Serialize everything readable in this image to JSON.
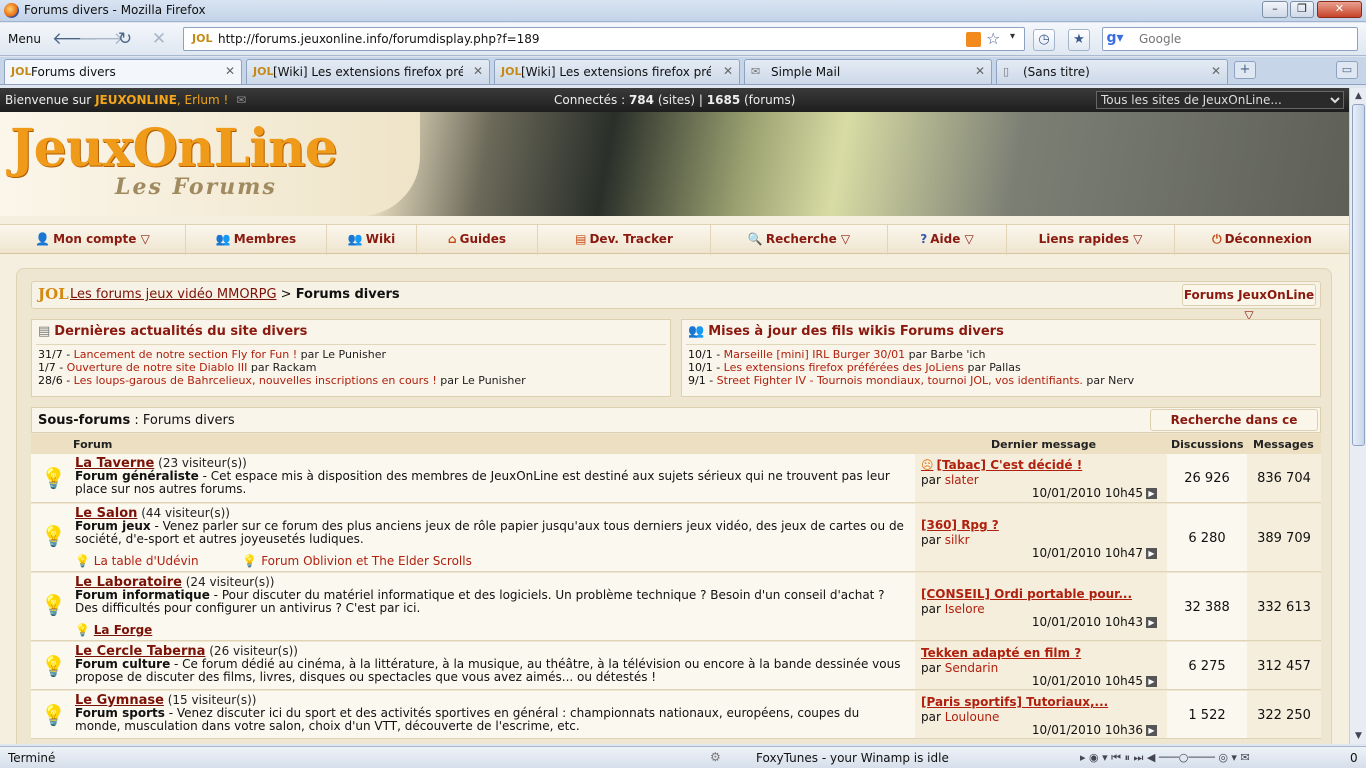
{
  "window": {
    "title": "Forums divers - Mozilla Firefox",
    "min": "–",
    "max": "❐",
    "close": "✕"
  },
  "nav": {
    "menu": "Menu",
    "url": "http://forums.jeuxonline.info/forumdisplay.php?f=189",
    "search_placeholder": "Google"
  },
  "tabs": [
    {
      "label": "Forums divers"
    },
    {
      "label": "[Wiki] Les extensions firefox préféré..."
    },
    {
      "label": "[Wiki] Les extensions firefox préféré..."
    },
    {
      "label": "Simple Mail"
    },
    {
      "label": "(Sans titre)"
    }
  ],
  "topstrip": {
    "welcome_prefix": "Bienvenue sur ",
    "brand": "JEUXONLINE",
    "user": ", Erlum !",
    "conn_label": "Connectés : ",
    "conn_sites": "784",
    "conn_sites_label": " (sites) | ",
    "conn_forums": "1685",
    "conn_forums_label": " (forums)",
    "sites_select": "Tous les sites de JeuxOnLine..."
  },
  "banner": {
    "logo": "JeuxOnLine",
    "subtitle": "Les Forums"
  },
  "mainnav": [
    {
      "label": "Mon compte ▽",
      "icon": "👤"
    },
    {
      "label": "Membres",
      "icon": "👥"
    },
    {
      "label": "Wiki",
      "icon": "👥"
    },
    {
      "label": "Guides",
      "icon": "⌂"
    },
    {
      "label": "Dev. Tracker",
      "icon": "▤"
    },
    {
      "label": "Recherche ▽",
      "icon": "🔍"
    },
    {
      "label": "Aide ▽",
      "icon": "?"
    },
    {
      "label": "Liens rapides ▽",
      "icon": ""
    },
    {
      "label": "Déconnexion",
      "icon": "⏻"
    }
  ],
  "breadcrumb": {
    "logo": "JOL",
    "parent": "Les forums jeux vidéo MMORPG",
    "sep": " > ",
    "current": "Forums divers",
    "dropdown": "Forums JeuxOnLine ▽"
  },
  "news_left": {
    "title": "Dernières actualités du site divers",
    "items": [
      {
        "date": "31/7 - ",
        "link": "Lancement de notre section Fly for Fun !",
        "by": " par Le Punisher"
      },
      {
        "date": "1/7 - ",
        "link": "Ouverture de notre site Diablo III",
        "by": " par Rackam"
      },
      {
        "date": "28/6 - ",
        "link": "Les loups-garous de Bahrcelieux, nouvelles inscriptions en cours !",
        "by": " par Le Punisher"
      }
    ]
  },
  "news_right": {
    "title": "Mises à jour des fils wikis Forums divers",
    "items": [
      {
        "date": "10/1 - ",
        "link": "Marseille [mini] IRL Burger 30/01",
        "by": " par Barbe 'ich"
      },
      {
        "date": "10/1 - ",
        "link": "Les extensions firefox préférées des JoLiens",
        "by": " par Pallas"
      },
      {
        "date": "9/1 - ",
        "link": "Street Fighter IV - Tournois mondiaux, tournoi JOL, vos identifiants.",
        "by": " par Nerv"
      }
    ]
  },
  "subforums": {
    "label": "Sous-forums",
    "sep": " : ",
    "name": "Forums divers",
    "search_btn": "Recherche dans ce forum ▽"
  },
  "table_headers": {
    "forum": "Forum",
    "last": "Dernier message",
    "disc": "Discussions",
    "msgs": "Messages"
  },
  "forums": [
    {
      "title": "La Taverne",
      "visitors": " (23 visiteur(s))",
      "subtitle": "Forum généraliste",
      "desc": " - Cet espace mis à disposition des membres de JeuxOnLine est destiné aux sujets sérieux qui ne trouvent pas leur place sur nos autres forums.",
      "last_title": "[Tabac] C'est décidé !",
      "last_by": "slater",
      "last_date": "10/01/2010 10h45",
      "disc": "26 926",
      "msgs": "836 704"
    },
    {
      "title": "Le Salon",
      "visitors": " (44 visiteur(s))",
      "subtitle": "Forum jeux",
      "desc": " - Venez parler sur ce forum des plus anciens jeux de rôle papier jusqu'aux tous derniers jeux vidéo, des jeux de cartes ou de société, d'e-sport et autres joyeusetés ludiques.",
      "subforums": [
        "La table d'Udévin",
        "Forum Oblivion et The Elder Scrolls"
      ],
      "last_title": "[360] Rpg ?",
      "last_by": "silkr",
      "last_date": "10/01/2010 10h47",
      "disc": "6 280",
      "msgs": "389 709"
    },
    {
      "title": "Le Laboratoire",
      "visitors": " (24 visiteur(s))",
      "subtitle": "Forum informatique",
      "desc": " - Pour discuter du matériel informatique et des logiciels. Un problème technique ? Besoin d'un conseil d'achat ? Des difficultés pour configurer un antivirus ? C'est par ici.",
      "subforums": [
        "La Forge"
      ],
      "last_title": "[CONSEIL] Ordi portable pour...",
      "last_by": "Iselore",
      "last_date": "10/01/2010 10h43",
      "disc": "32 388",
      "msgs": "332 613"
    },
    {
      "title": "Le Cercle Taberna",
      "visitors": " (26 visiteur(s))",
      "subtitle": "Forum culture",
      "desc": " - Ce forum dédié au cinéma, à la littérature, à la musique, au théâtre, à la télévision ou encore à la bande dessinée vous propose de discuter des films, livres, disques ou spectacles que vous avez aimés... ou détestés !",
      "last_title": "Tekken adapté en film ?",
      "last_by": "Sendarin",
      "last_date": "10/01/2010 10h45",
      "disc": "6 275",
      "msgs": "312 457"
    },
    {
      "title": "Le Gymnase",
      "visitors": " (15 visiteur(s))",
      "subtitle": "Forum sports",
      "desc": " - Venez discuter ici du sport et des activités sportives en général : championnats nationaux, européens, coupes du monde, musculation dans votre salon, choix d'un VTT, découverte de l'escrime, etc.",
      "last_title": "[Paris sportifs] Tutoriaux,...",
      "last_by": "Louloune",
      "last_date": "10/01/2010 10h36",
      "disc": "1 522",
      "msgs": "322 250"
    }
  ],
  "by_label": "par ",
  "status": {
    "text": "Terminé",
    "foxytunes": "FoxyTunes - your Winamp is idle",
    "count": "0"
  }
}
